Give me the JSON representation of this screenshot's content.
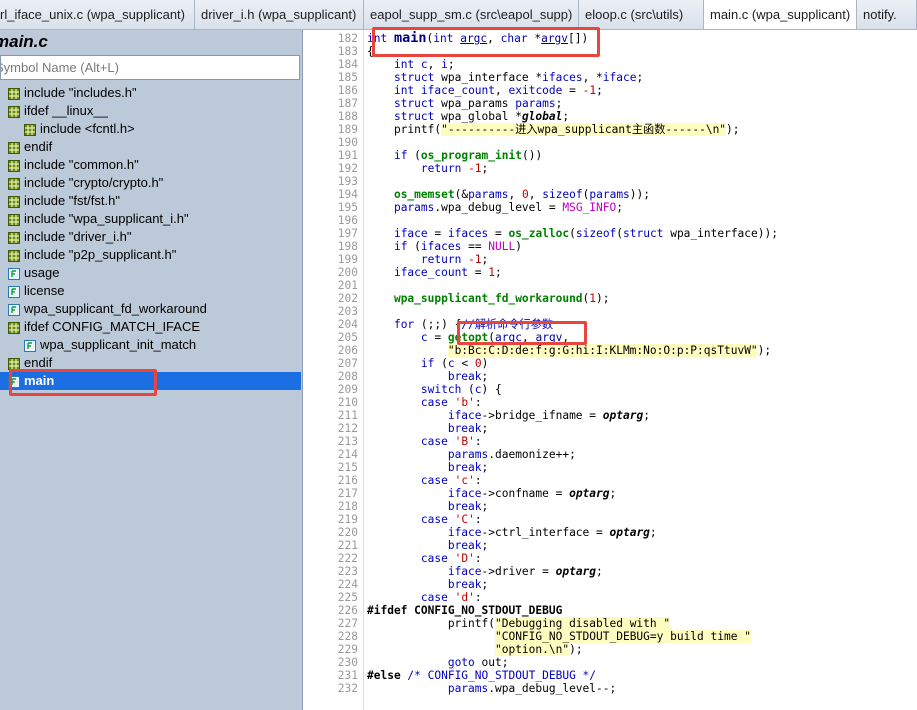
{
  "tabs": [
    {
      "label": "rl_iface_unix.c (wpa_supplicant)",
      "active": false
    },
    {
      "label": "driver_i.h (wpa_supplicant)",
      "active": false
    },
    {
      "label": "eapol_supp_sm.c (src\\eapol_supp)",
      "active": false
    },
    {
      "label": "eloop.c (src\\utils)",
      "active": false
    },
    {
      "label": "main.c (wpa_supplicant)",
      "active": true
    },
    {
      "label": "notify.",
      "active": false
    }
  ],
  "tab_close_glyph": "×",
  "symbol_panel": {
    "title": "main.c",
    "search_placeholder": "Symbol Name (Alt+L)",
    "items": [
      {
        "label": "include \"includes.h\"",
        "icon": "include-icon",
        "indent": 0
      },
      {
        "label": "ifdef __linux__",
        "icon": "ifdef-icon",
        "indent": 0
      },
      {
        "label": "include <fcntl.h>",
        "icon": "include-icon",
        "indent": 1
      },
      {
        "label": "endif",
        "icon": "endif-icon",
        "indent": 0
      },
      {
        "label": "include \"common.h\"",
        "icon": "include-icon",
        "indent": 0
      },
      {
        "label": "include \"crypto/crypto.h\"",
        "icon": "include-icon",
        "indent": 0
      },
      {
        "label": "include \"fst/fst.h\"",
        "icon": "include-icon",
        "indent": 0
      },
      {
        "label": "include \"wpa_supplicant_i.h\"",
        "icon": "include-icon",
        "indent": 0
      },
      {
        "label": "include \"driver_i.h\"",
        "icon": "include-icon",
        "indent": 0
      },
      {
        "label": "include \"p2p_supplicant.h\"",
        "icon": "include-icon",
        "indent": 0
      },
      {
        "label": "usage",
        "icon": "function-icon",
        "indent": 0
      },
      {
        "label": "license",
        "icon": "function-icon",
        "indent": 0
      },
      {
        "label": "wpa_supplicant_fd_workaround",
        "icon": "function-icon",
        "indent": 0
      },
      {
        "label": "ifdef CONFIG_MATCH_IFACE",
        "icon": "ifdef-icon",
        "indent": 0
      },
      {
        "label": "wpa_supplicant_init_match",
        "icon": "function-icon",
        "indent": 1
      },
      {
        "label": "endif",
        "icon": "endif-icon",
        "indent": 0
      },
      {
        "label": "main",
        "icon": "function-icon",
        "indent": 0,
        "selected": true
      }
    ]
  },
  "editor": {
    "lines": [
      {
        "n": "182",
        "t": "int main(int argc, char *argv[])"
      },
      {
        "n": "183",
        "t": "{"
      },
      {
        "n": "184",
        "t": "    int c, i;"
      },
      {
        "n": "185",
        "t": "    struct wpa_interface *ifaces, *iface;"
      },
      {
        "n": "186",
        "t": "    int iface_count, exitcode = -1;"
      },
      {
        "n": "187",
        "t": "    struct wpa_params params;"
      },
      {
        "n": "188",
        "t": "    struct wpa_global *global;"
      },
      {
        "n": "189",
        "t": "    printf(\"----------进入wpa_supplicant主函数------\\n\");"
      },
      {
        "n": "190",
        "t": ""
      },
      {
        "n": "191",
        "t": "    if (os_program_init())"
      },
      {
        "n": "192",
        "t": "        return -1;"
      },
      {
        "n": "193",
        "t": ""
      },
      {
        "n": "194",
        "t": "    os_memset(&params, 0, sizeof(params));"
      },
      {
        "n": "195",
        "t": "    params.wpa_debug_level = MSG_INFO;"
      },
      {
        "n": "196",
        "t": ""
      },
      {
        "n": "197",
        "t": "    iface = ifaces = os_zalloc(sizeof(struct wpa_interface));"
      },
      {
        "n": "198",
        "t": "    if (ifaces == NULL)"
      },
      {
        "n": "199",
        "t": "        return -1;"
      },
      {
        "n": "200",
        "t": "    iface_count = 1;"
      },
      {
        "n": "201",
        "t": ""
      },
      {
        "n": "202",
        "t": "    wpa_supplicant_fd_workaround(1);"
      },
      {
        "n": "203",
        "t": ""
      },
      {
        "n": "204",
        "t": "    for (;;) {//解析命令行参数"
      },
      {
        "n": "205",
        "t": "        c = getopt(argc, argv,"
      },
      {
        "n": "206",
        "t": "            \"b:Bc:C:D:de:f:g:G:hi:I:KLMm:No:O:p:P:qsTtuvW\");"
      },
      {
        "n": "207",
        "t": "        if (c < 0)"
      },
      {
        "n": "208",
        "t": "            break;"
      },
      {
        "n": "209",
        "t": "        switch (c) {"
      },
      {
        "n": "210",
        "t": "        case 'b':"
      },
      {
        "n": "211",
        "t": "            iface->bridge_ifname = optarg;"
      },
      {
        "n": "212",
        "t": "            break;"
      },
      {
        "n": "213",
        "t": "        case 'B':"
      },
      {
        "n": "214",
        "t": "            params.daemonize++;"
      },
      {
        "n": "215",
        "t": "            break;"
      },
      {
        "n": "216",
        "t": "        case 'c':"
      },
      {
        "n": "217",
        "t": "            iface->confname = optarg;"
      },
      {
        "n": "218",
        "t": "            break;"
      },
      {
        "n": "219",
        "t": "        case 'C':"
      },
      {
        "n": "220",
        "t": "            iface->ctrl_interface = optarg;"
      },
      {
        "n": "221",
        "t": "            break;"
      },
      {
        "n": "222",
        "t": "        case 'D':"
      },
      {
        "n": "223",
        "t": "            iface->driver = optarg;"
      },
      {
        "n": "224",
        "t": "            break;"
      },
      {
        "n": "225",
        "t": "        case 'd':"
      },
      {
        "n": "226",
        "t": "#ifdef CONFIG_NO_STDOUT_DEBUG"
      },
      {
        "n": "227",
        "t": "            printf(\"Debugging disabled with \""
      },
      {
        "n": "228",
        "t": "                   \"CONFIG_NO_STDOUT_DEBUG=y build time \""
      },
      {
        "n": "229",
        "t": "                   \"option.\\n\");"
      },
      {
        "n": "230",
        "t": "            goto out;"
      },
      {
        "n": "231",
        "t": "#else /* CONFIG_NO_STDOUT_DEBUG */"
      },
      {
        "n": "232",
        "t": "            params.wpa_debug_level--;"
      }
    ]
  },
  "colors": {
    "highlight_box": "#e8453c",
    "selection": "#1c6fe3",
    "panel_bg": "#bcc9d9",
    "keyword": "#0000c0",
    "function": "#008000",
    "number": "#c00000",
    "macro": "#c000c0"
  }
}
